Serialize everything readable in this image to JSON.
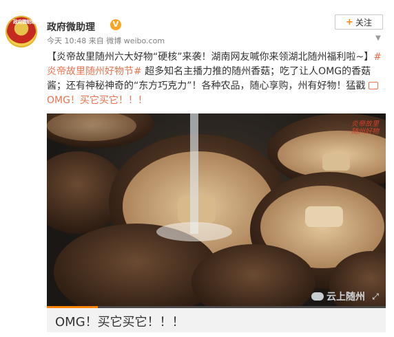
{
  "post": {
    "username": "政府微助理",
    "verified_badge": "V",
    "avatar_seal": "政府微助理",
    "time": "今天 10:48",
    "source_prefix": "来自",
    "source": "微博 weibo.com",
    "follow_label": "关注",
    "text": {
      "part1": "【炎帝故里随州六大好物“硬核”来袭！湖南网友喊你来领湖北随州福利啦~】",
      "hashtag": "#炎帝故里随州好物节#",
      "part2": " 超多知名主播力推的随州香菇；吃了让人OMG的香菇酱；还有神秘神奇的“东方巧克力”！各种农品，随心享购，州有好物！猛戳",
      "video_link": "OMG！买它买它！！！"
    }
  },
  "video": {
    "watermark_top": "炎帝故里\n随州好物",
    "watermark_bottom": "云上随州",
    "progress": 0.15,
    "caption": "OMG！买它买它！！！"
  },
  "colors": {
    "accent": "#eb7350",
    "brand": "#ff8200",
    "verified": "#f5a623"
  }
}
